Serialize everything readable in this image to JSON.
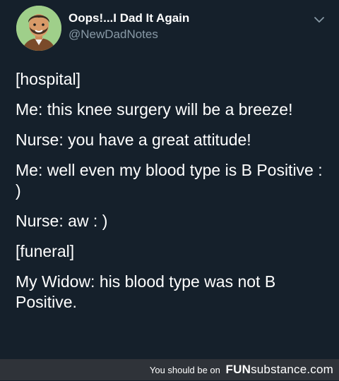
{
  "tweet": {
    "author_name": "Oops!...I Dad It Again",
    "author_handle": "@NewDadNotes",
    "lines": [
      "[hospital]",
      "Me: this knee surgery will be a breeze!",
      "Nurse: you have a great attitude!",
      "Me: well even my blood type is B Positive : )",
      "Nurse: aw : )",
      "[funeral]",
      "My Widow: his blood type was not B Positive."
    ],
    "menu_icon": "chevron-down-icon",
    "avatar_icon": "cartoon-avatar"
  },
  "footer": {
    "prefix": "You should be on",
    "brand_part1": "FUN",
    "brand_part2": "substance",
    "brand_part3": ".com"
  },
  "colors": {
    "background": "#15202b",
    "secondary_text": "#8899a6",
    "footer_bg": "#2f3339"
  }
}
